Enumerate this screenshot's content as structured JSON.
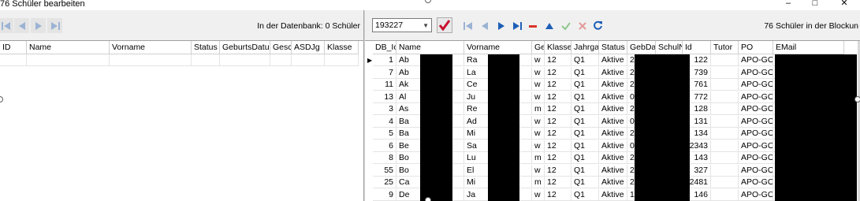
{
  "window": {
    "title": "76 Schüler bearbeiten",
    "controls": {
      "minimize": "–",
      "maximize": "□",
      "close": "✕"
    }
  },
  "left_panel": {
    "info_text": "In der Datenbank: 0 Schüler",
    "columns": [
      "ID",
      "Name",
      "Vorname",
      "Status",
      "GeburtsDatum",
      "Gesch",
      "ASDJg",
      "Klasse"
    ]
  },
  "right_panel": {
    "combo_value": "193227",
    "info_text": "76 Schüler in der Blockun",
    "columns": [
      "DB_Ic",
      "Name",
      "Vorname",
      "Ges",
      "Klasse",
      "Jahrgar",
      "Status",
      "GebDat",
      "SchulN",
      "Id",
      "Tutor",
      "PO",
      "EMail"
    ],
    "rows": [
      {
        "db": "1",
        "name": "Ab",
        "vorname": "Ra",
        "g": "w",
        "kl": "12",
        "jg": "Q1",
        "st": "Aktive",
        "geb": "2",
        "id": "122",
        "po": "APO-GOS"
      },
      {
        "db": "7",
        "name": "Ab",
        "vorname": "La",
        "g": "w",
        "kl": "12",
        "jg": "Q1",
        "st": "Aktive",
        "geb": "2",
        "id": "739",
        "po": "APO-GOS"
      },
      {
        "db": "11",
        "name": "Ak",
        "vorname": "Ce",
        "g": "w",
        "kl": "12",
        "jg": "Q1",
        "st": "Aktive",
        "geb": "2",
        "id": "761",
        "po": "APO-GOS"
      },
      {
        "db": "13",
        "name": "Al",
        "vorname": "Ju",
        "g": "w",
        "kl": "12",
        "jg": "Q1",
        "st": "Aktive",
        "geb": "0",
        "id": "772",
        "po": "APO-GOS"
      },
      {
        "db": "3",
        "name": "As",
        "vorname": "Re",
        "g": "m",
        "kl": "12",
        "jg": "Q1",
        "st": "Aktive",
        "geb": "2",
        "id": "128",
        "po": "APO-GOS"
      },
      {
        "db": "4",
        "name": "Ba",
        "vorname": "Ad",
        "g": "w",
        "kl": "12",
        "jg": "Q1",
        "st": "Aktive",
        "geb": "0",
        "id": "131",
        "po": "APO-GOS"
      },
      {
        "db": "5",
        "name": "Ba",
        "vorname": "Mi",
        "g": "w",
        "kl": "12",
        "jg": "Q1",
        "st": "Aktive",
        "geb": "2",
        "id": "134",
        "po": "APO-GOS"
      },
      {
        "db": "6",
        "name": "Be",
        "vorname": "Sa",
        "g": "w",
        "kl": "12",
        "jg": "Q1",
        "st": "Aktive",
        "geb": "0",
        "id": "2343",
        "po": "APO-GOS"
      },
      {
        "db": "8",
        "name": "Bo",
        "vorname": "Lu",
        "g": "m",
        "kl": "12",
        "jg": "Q1",
        "st": "Aktive",
        "geb": "2",
        "id": "143",
        "po": "APO-GOS"
      },
      {
        "db": "55",
        "name": "Bo",
        "vorname": "El",
        "g": "w",
        "kl": "12",
        "jg": "Q1",
        "st": "Aktive",
        "geb": "2",
        "id": "327",
        "po": "APO-GOS"
      },
      {
        "db": "25",
        "name": "Ca",
        "vorname": "Mi",
        "g": "m",
        "kl": "12",
        "jg": "Q1",
        "st": "Aktive",
        "geb": "2",
        "id": "2481",
        "po": "APO-GOS"
      },
      {
        "db": "9",
        "name": "De",
        "vorname": "Ja",
        "g": "w",
        "kl": "12",
        "jg": "Q1",
        "st": "Aktive",
        "geb": "1",
        "id": "146",
        "po": "APO-GOS"
      }
    ]
  },
  "icons": {
    "nav": [
      "first-icon",
      "prev-icon",
      "next-icon",
      "last-icon"
    ],
    "edit": [
      "delete-icon",
      "up-icon",
      "confirm-icon",
      "cancel-icon",
      "refresh-icon"
    ]
  },
  "colors": {
    "nav_blue": "#1e5fb8",
    "nav_disabled": "#9bb3d4",
    "delete_red": "#d9342b",
    "check_red": "#c8102e",
    "confirm_green": "#8fc88f",
    "cancel_red": "#e39a9a"
  }
}
